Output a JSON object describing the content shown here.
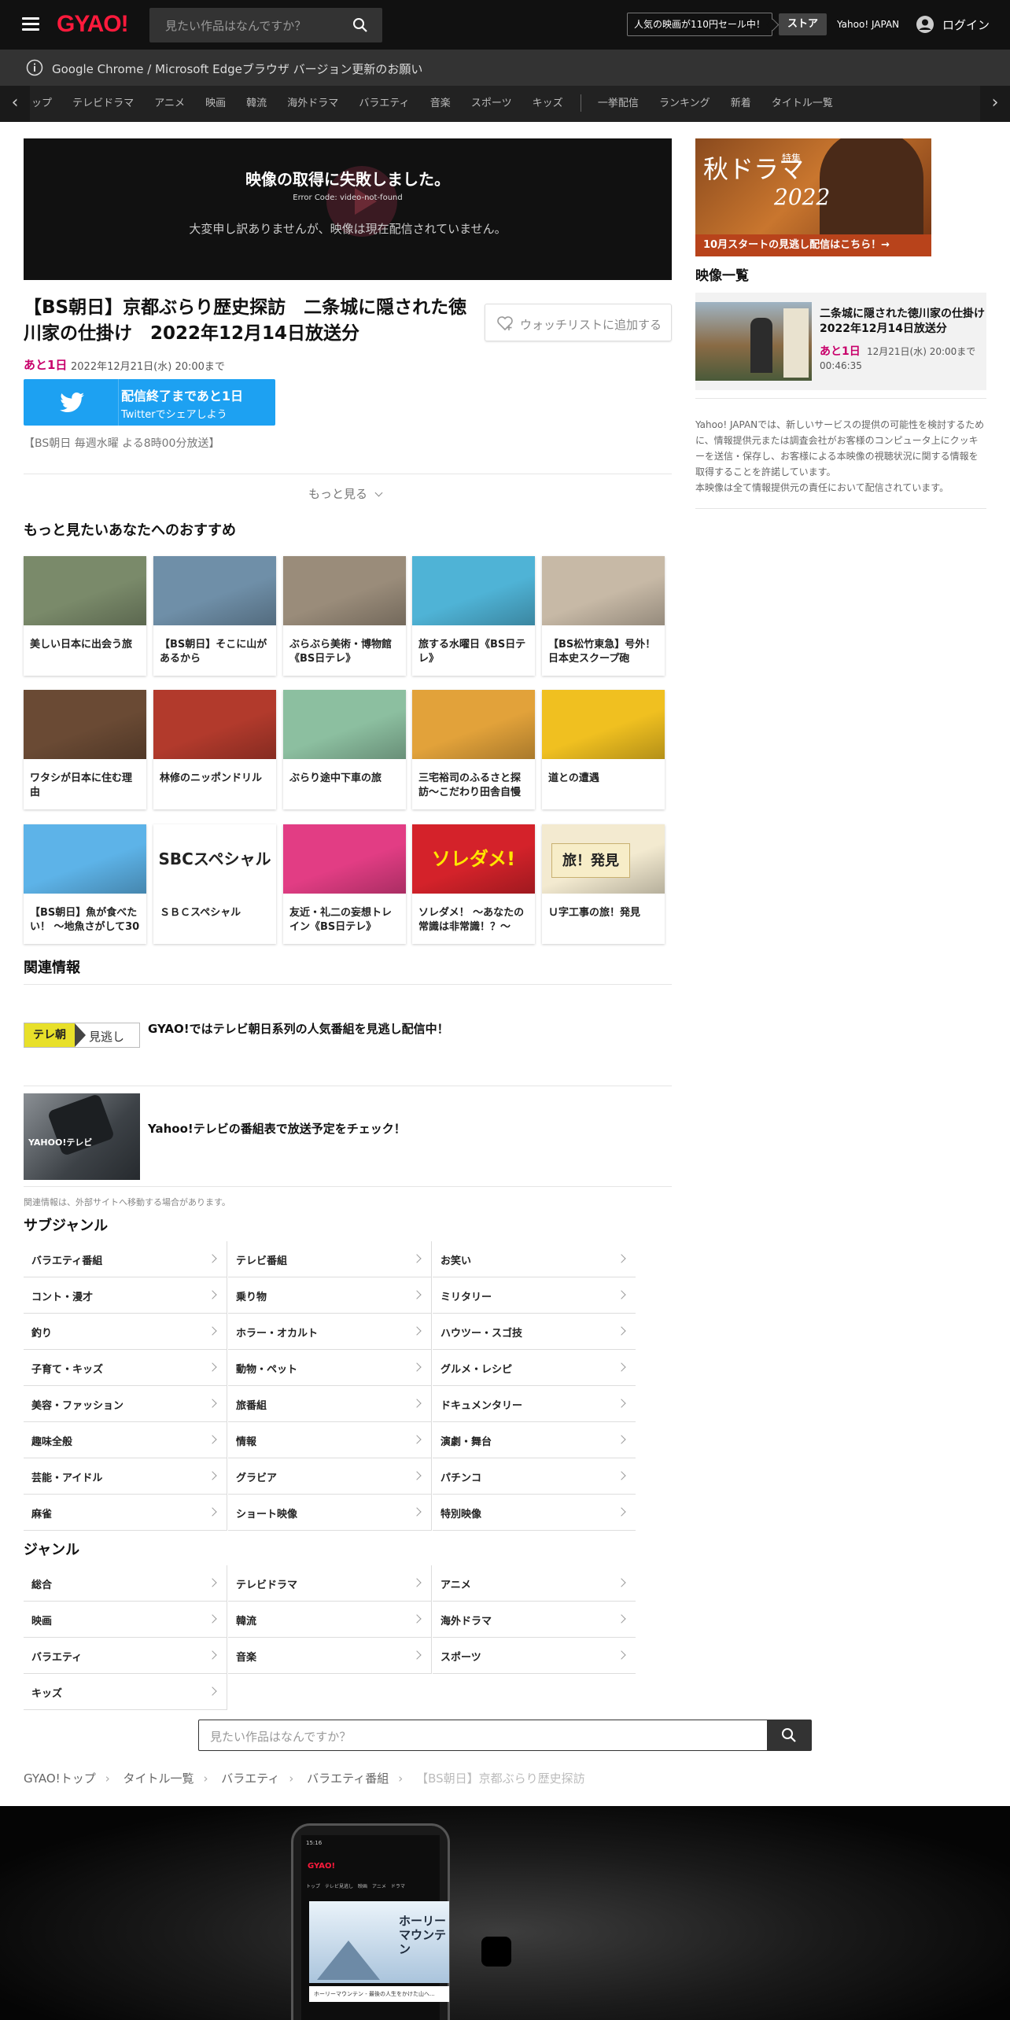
{
  "header": {
    "logo": "GYAO!",
    "search_placeholder": "見たい作品はなんですか？",
    "promo": "人気の映画が110円セール中！",
    "store": "ストア",
    "yahoo": "Yahoo! JAPAN",
    "login": "ログイン"
  },
  "notice": "Google Chrome / Microsoft Edgeブラウザ バージョン更新のお願い",
  "nav": {
    "items_a": [
      "ップ",
      "テレビドラマ",
      "アニメ",
      "映画",
      "韓流",
      "海外ドラマ",
      "バラエティ",
      "音楽",
      "スポーツ",
      "キッズ"
    ],
    "items_b": [
      "一挙配信",
      "ランキング",
      "新着",
      "タイトル一覧"
    ],
    "prev": "‹",
    "next": "›"
  },
  "player": {
    "error_title": "映像の取得に失敗しました。",
    "error_code": "Error Code: video-not-found",
    "error_message": "大変申し訳ありませんが、映像は現在配信されていません。"
  },
  "episode": {
    "title": "【BS朝日】京都ぶらり歴史探訪　二条城に隠された徳川家の仕掛け　2022年12月14日放送分",
    "watchlist": "ウォッチリストに追加する",
    "remaining": "あと1日",
    "until": "2022年12月21日(水) 20:00まで",
    "twitter_line1": "配信終了まであと1日",
    "twitter_line2": "Twitterでシェアしよう",
    "broadcast": "【BS朝日 毎週水曜 よる8時00分放送】",
    "more": "もっと見る"
  },
  "recommend": {
    "heading": "もっと見たいあなたへのおすすめ",
    "items": [
      {
        "title": "美しい日本に出会う旅",
        "color": "#7a8a6a"
      },
      {
        "title": "【BS朝日】そこに山があるから",
        "color": "#6f8fa8"
      },
      {
        "title": "ぶらぶら美術・博物館《BS日テレ》",
        "color": "#9a8c7a"
      },
      {
        "title": "旅する水曜日《BS日テレ》",
        "color": "#4fb3d6"
      },
      {
        "title": "【BS松竹東急】号外！日本史スクープ砲",
        "color": "#c7b9a6"
      },
      {
        "title": "ワタシが日本に住む理由",
        "color": "#6a4a34"
      },
      {
        "title": "林修のニッポンドリル",
        "color": "#b23a2c"
      },
      {
        "title": "ぶらり途中下車の旅",
        "color": "#8cbfa0"
      },
      {
        "title": "三宅裕司のふるさと探訪～こだわり田舎自慢",
        "color": "#e2a23a"
      },
      {
        "title": "道との遭遇",
        "color": "#f0c020"
      },
      {
        "title": "【BS朝日】魚が食べたい！ ～地魚さがして30",
        "color": "#5db3e8"
      },
      {
        "title": "ＳＢＣスペシャル",
        "color": "#ffffff"
      },
      {
        "title": "友近・礼二の妄想トレイン《BS日テレ》",
        "color": "#e23d84"
      },
      {
        "title": "ソレダメ！ ～あなたの常識は非常識！？～",
        "color": "#d4222a"
      },
      {
        "title": "Ｕ字工事の旅！発見",
        "color": "#f3ead0"
      }
    ],
    "logo_text_12": "SBCスペシャル",
    "logo_text_15": "旅！発見",
    "logo_text_14": "ソレダメ!"
  },
  "related": {
    "heading": "関連情報",
    "items": [
      {
        "logo": "テレ朝",
        "logo2": "見逃し",
        "text": "GYAO!ではテレビ朝日系列の人気番組を見逃し配信中！"
      },
      {
        "logo": "YAHOO!テレビ",
        "text": "Yahoo!テレビの番組表で放送予定をチェック！"
      }
    ],
    "note": "関連情報は、外部サイトへ移動する場合があります。"
  },
  "subgenre": {
    "heading": "サブジャンル",
    "items": [
      "バラエティ番組",
      "テレビ番組",
      "お笑い",
      "コント・漫才",
      "乗り物",
      "ミリタリー",
      "釣り",
      "ホラー・オカルト",
      "ハウツー・スゴ技",
      "子育て・キッズ",
      "動物・ペット",
      "グルメ・レシピ",
      "美容・ファッション",
      "旅番組",
      "ドキュメンタリー",
      "趣味全般",
      "情報",
      "演劇・舞台",
      "芸能・アイドル",
      "グラビア",
      "パチンコ",
      "麻雀",
      "ショート映像",
      "特別映像"
    ]
  },
  "genre": {
    "heading": "ジャンル",
    "items": [
      "総合",
      "テレビドラマ",
      "アニメ",
      "映画",
      "韓流",
      "海外ドラマ",
      "バラエティ",
      "音楽",
      "スポーツ",
      "キッズ"
    ]
  },
  "sidebar": {
    "banner_title": "秋ドラマ",
    "banner_sub": "特集",
    "banner_year": "2022",
    "banner_cta": "10月スタートの見逃し配信はこちら！→",
    "video_list_heading": "映像一覧",
    "video_title": "二条城に隠された徳川家の仕掛け　2022年12月14日放送分",
    "video_remaining": "あと1日",
    "video_until": "12月21日(水) 20:00まで",
    "video_duration": "00:46:35",
    "disclaimer": "Yahoo! JAPANでは、新しいサービスの提供の可能性を検討するために、情報提供元または調査会社がお客様のコンピュータ上にクッキーを送信・保存し、お客様による本映像の視聴状況に関する情報を取得することを許諾しています。",
    "disclaimer2": "本映像は全て情報提供元の責任において配信されています。"
  },
  "bottom_search_placeholder": "見たい作品はなんですか？",
  "breadcrumb": [
    "GYAO!トップ",
    "タイトル一覧",
    "バラエティ",
    "バラエティ番組",
    "【BS朝日】京都ぶらり歴史探訪"
  ],
  "footer_phone": {
    "status": "15:16",
    "logo": "GYAO!",
    "tabs": "トップ　テレビ見逃し　映画　アニメ　ドラマ",
    "image_title": "ホーリー\nマウンテン",
    "caption": "ホーリーマウンテン - 最後の人生をかけた山へ..."
  }
}
